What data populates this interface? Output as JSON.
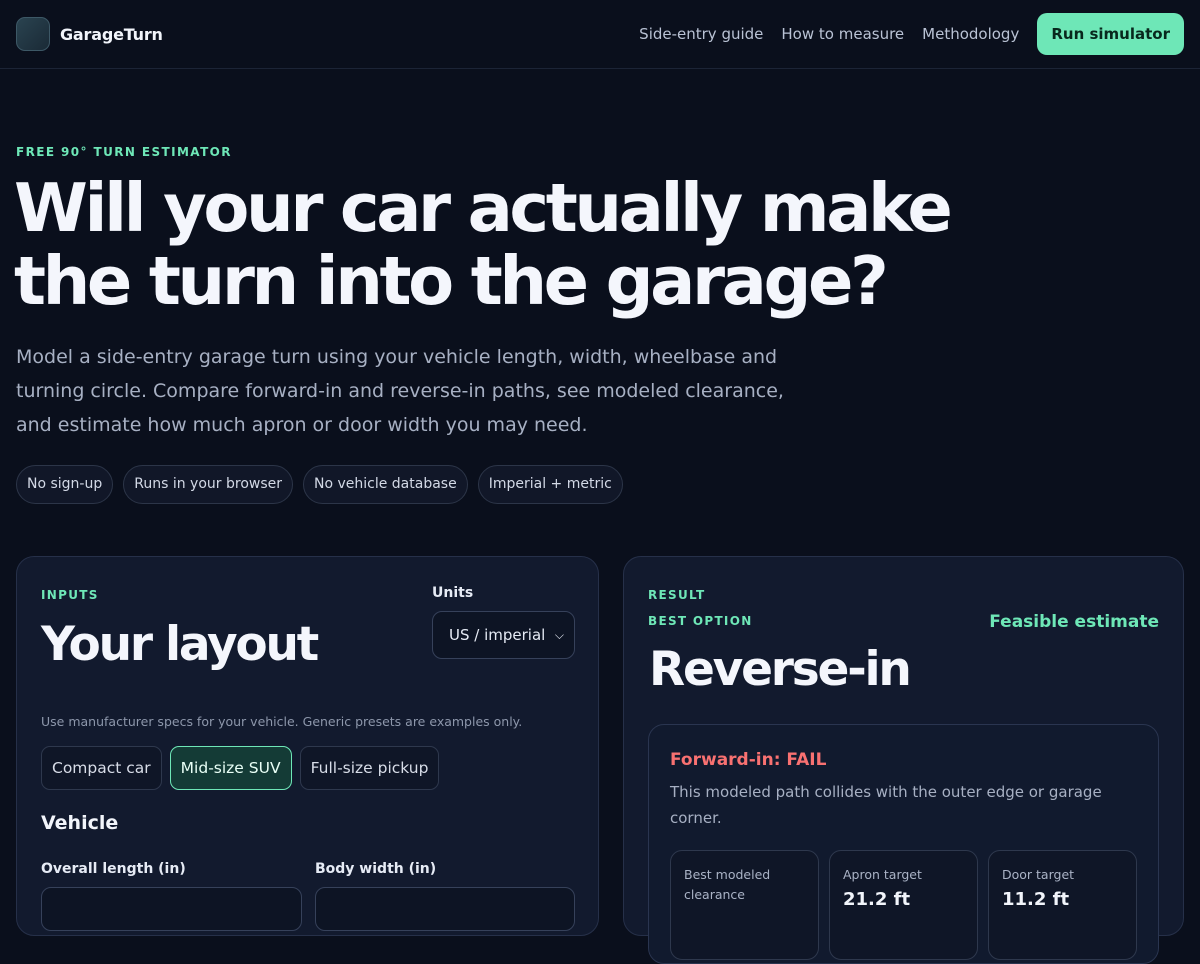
{
  "header": {
    "brand": "GarageTurn",
    "nav": [
      "Side-entry guide",
      "How to measure",
      "Methodology"
    ],
    "cta": "Run simulator"
  },
  "hero": {
    "eyebrow": "FREE 90° TURN ESTIMATOR",
    "title_line1": "Will your car actually make",
    "title_line2": "the turn into the garage?",
    "subtitle": "Model a side-entry garage turn using your vehicle length, width, wheelbase and turning circle. Compare forward-in and reverse-in paths, see modeled clearance, and estimate how much apron or door width you may need.",
    "pills": [
      "No sign-up",
      "Runs in your browser",
      "No vehicle database",
      "Imperial + metric"
    ]
  },
  "inputs": {
    "eyebrow": "INPUTS",
    "title": "Your layout",
    "units_label": "Units",
    "units_value": "US / imperial",
    "hint": "Use manufacturer specs for your vehicle. Generic presets are examples only.",
    "presets": [
      "Compact car",
      "Mid-size SUV",
      "Full-size pickup"
    ],
    "active_preset": "Mid-size SUV",
    "section": "Vehicle",
    "fields": [
      "Overall length (in)",
      "Body width (in)"
    ]
  },
  "result": {
    "eyebrow": "RESULT",
    "best_label": "BEST OPTION",
    "status": "Feasible estimate",
    "best": "Reverse-in",
    "forward_title": "Forward-in: FAIL",
    "forward_desc": "This modeled path collides with the outer edge or garage corner.",
    "metrics": [
      {
        "label": "Best modeled clearance",
        "value": ""
      },
      {
        "label": "Apron target",
        "value": "21.2 ft"
      },
      {
        "label": "Door target",
        "value": "11.2 ft"
      }
    ]
  },
  "colors": {
    "accent": "#6ee7b7",
    "fail": "#f87171",
    "background": "#0a0f1c"
  }
}
